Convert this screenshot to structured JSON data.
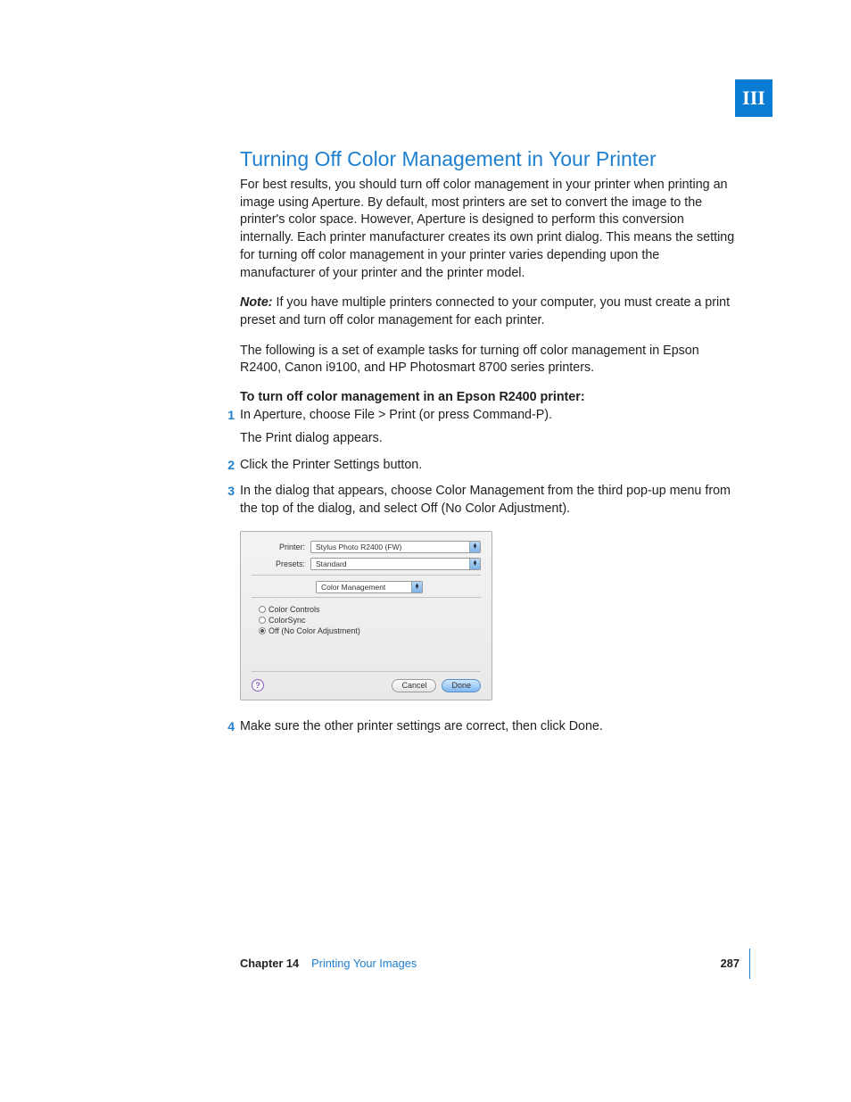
{
  "tab_label": "III",
  "heading": "Turning Off Color Management in Your Printer",
  "para1": "For best results, you should turn off color management in your printer when printing an image using Aperture. By default, most printers are set to convert the image to the printer's color space. However, Aperture is designed to perform this conversion internally. Each printer manufacturer creates its own print dialog. This means the setting for turning off color management in your printer varies depending upon the manufacturer of your printer and the printer model.",
  "note_label": "Note:",
  "note_text": "  If you have multiple printers connected to your computer, you must create a print preset and turn off color management for each printer.",
  "para2": "The following is a set of example tasks for turning off color management in Epson R2400, Canon i9100, and HP Photosmart 8700 series printers.",
  "subhead": "To turn off color management in an Epson R2400 printer:",
  "steps": {
    "s1_num": "1",
    "s1_text": "In Aperture, choose File > Print (or press Command-P).",
    "s1_sub": "The Print dialog appears.",
    "s2_num": "2",
    "s2_text": "Click the Printer Settings button.",
    "s3_num": "3",
    "s3_text": "In the dialog that appears, choose Color Management from the third pop-up menu from the top of the dialog, and select Off (No Color Adjustment).",
    "s4_num": "4",
    "s4_text": "Make sure the other printer settings are correct, then click Done."
  },
  "dialog": {
    "printer_label": "Printer:",
    "printer_value": "Stylus Photo R2400 (FW)",
    "presets_label": "Presets:",
    "presets_value": "Standard",
    "section_value": "Color Management",
    "radio1": "Color Controls",
    "radio2": "ColorSync",
    "radio3": "Off (No Color Adjustment)",
    "help": "?",
    "cancel": "Cancel",
    "done": "Done"
  },
  "footer": {
    "chapter": "Chapter 14",
    "title": "Printing Your Images",
    "page": "287"
  }
}
